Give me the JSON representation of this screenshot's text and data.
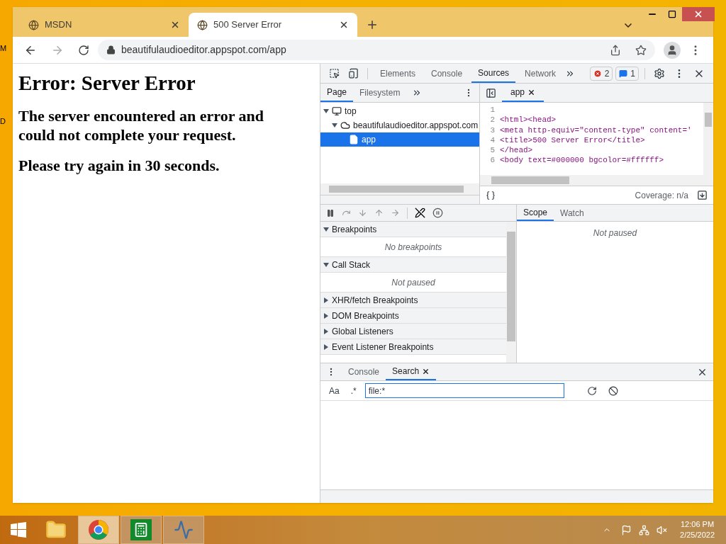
{
  "desktop": {
    "labels": [
      "M",
      "D"
    ]
  },
  "browser": {
    "tabs": [
      {
        "title": "MSDN",
        "selected": false
      },
      {
        "title": "500 Server Error",
        "selected": true
      }
    ],
    "address": "beautifulaudioeditor.appspot.com/app"
  },
  "page": {
    "heading": "Error: Server Error",
    "paragraphs": [
      "The server encountered an error and could not complete your request.",
      "Please try again in 30 seconds."
    ]
  },
  "devtools": {
    "tabs": [
      {
        "label": "Elements",
        "selected": false
      },
      {
        "label": "Console",
        "selected": false
      },
      {
        "label": "Sources",
        "selected": true
      },
      {
        "label": "Network",
        "selected": false
      }
    ],
    "errors": "2",
    "messages": "1",
    "navigator_tabs": [
      {
        "label": "Page",
        "selected": true
      },
      {
        "label": "Filesystem",
        "selected": false
      }
    ],
    "tree": [
      {
        "label": "top",
        "kind": "frame",
        "expanded": true,
        "selected": false,
        "children": [
          {
            "label": "beautifulaudioeditor.appspot.com",
            "kind": "domain",
            "expanded": true,
            "selected": false,
            "children": [
              {
                "label": "app",
                "kind": "file",
                "selected": true
              }
            ]
          }
        ]
      }
    ],
    "editor_tab": "app",
    "code_lines": [
      {
        "number": "1"
      },
      {
        "number": "2",
        "text": "<html><head>"
      },
      {
        "number": "3",
        "text": "<meta http-equiv=\"content-type\" content='"
      },
      {
        "number": "4",
        "text": "<title>500 Server Error</title>"
      },
      {
        "number": "5",
        "text": "</head>"
      },
      {
        "number": "6",
        "text": "<body text=#000000 bgcolor=#ffffff>"
      }
    ],
    "coverage": "Coverage: n/a",
    "sections": [
      {
        "title": "Breakpoints",
        "expanded": true,
        "message": "No breakpoints"
      },
      {
        "title": "Call Stack",
        "expanded": true,
        "message": "Not paused"
      },
      {
        "title": "XHR/fetch Breakpoints",
        "expanded": false
      },
      {
        "title": "DOM Breakpoints",
        "expanded": false
      },
      {
        "title": "Global Listeners",
        "expanded": false
      },
      {
        "title": "Event Listener Breakpoints",
        "expanded": false
      }
    ],
    "scope_tabs": [
      {
        "label": "Scope",
        "selected": true
      },
      {
        "label": "Watch",
        "selected": false
      }
    ],
    "scope_message": "Not paused",
    "drawer_tabs": [
      {
        "label": "Console",
        "selected": false,
        "closable": false
      },
      {
        "label": "Search",
        "selected": true,
        "closable": true
      }
    ],
    "search": {
      "case_label": "Aa",
      "regex_label": ".*",
      "value": "file:*"
    }
  },
  "taskbar": {
    "apps": [
      {
        "kind": "explorer",
        "running": false,
        "selected": false
      },
      {
        "kind": "chrome",
        "running": true,
        "selected": true
      },
      {
        "kind": "calculator",
        "running": true,
        "selected": false
      },
      {
        "kind": "monitor",
        "running": true,
        "selected": false
      }
    ],
    "time": "12:06 PM",
    "date": "2/25/2022"
  }
}
